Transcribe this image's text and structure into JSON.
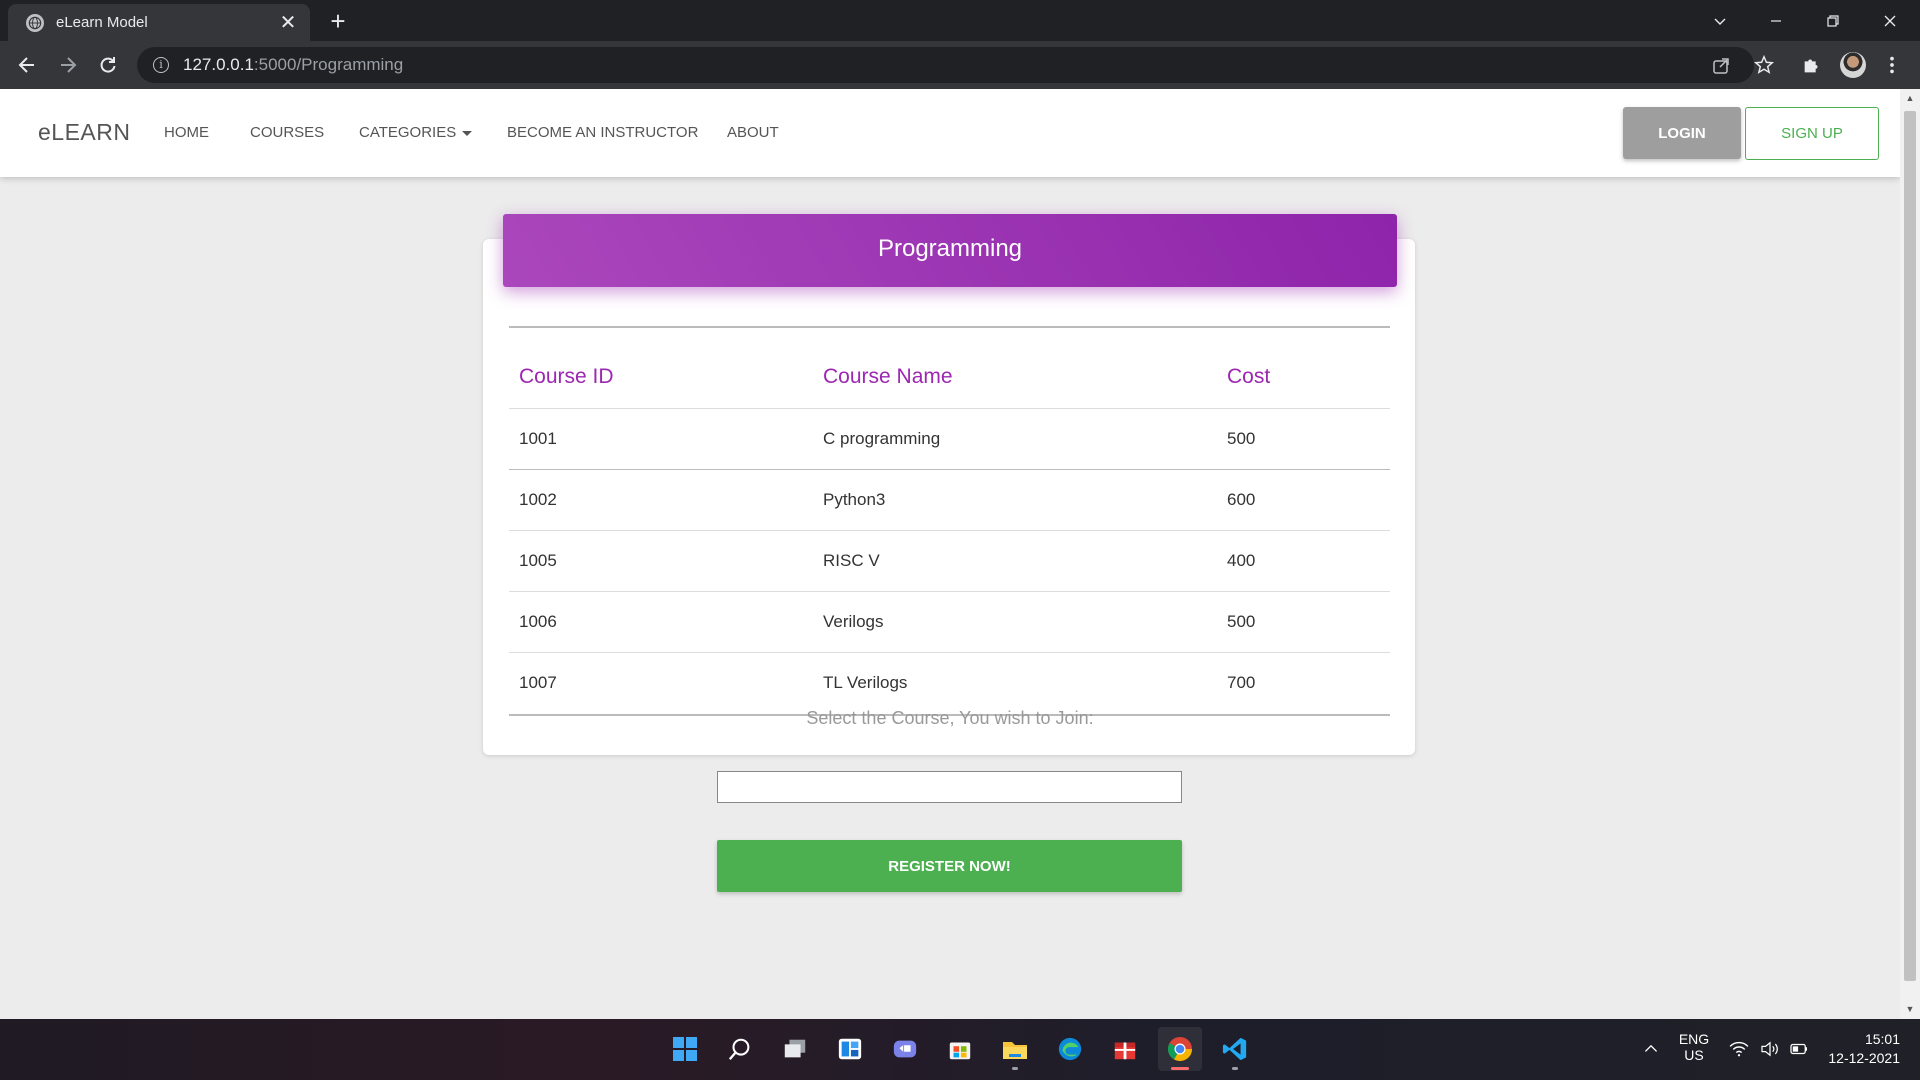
{
  "browser": {
    "tab_title": "eLearn Model",
    "tab_close": "✕",
    "new_tab": "+",
    "url_host": "127.0.0.1",
    "url_path": ":5000/Programming"
  },
  "navbar": {
    "brand": "eLEARN",
    "links": {
      "home": "HOME",
      "courses": "COURSES",
      "categories": "CATEGORIES",
      "instructor": "BECOME AN INSTRUCTOR",
      "about": "ABOUT"
    },
    "login": "LOGIN",
    "signup": "SIGN UP"
  },
  "card": {
    "title": "Programming",
    "headers": {
      "id": "Course ID",
      "name": "Course Name",
      "cost": "Cost"
    },
    "rows": [
      {
        "id": "1001",
        "name": "C programming",
        "cost": "500"
      },
      {
        "id": "1002",
        "name": "Python3",
        "cost": "600"
      },
      {
        "id": "1005",
        "name": "RISC V",
        "cost": "400"
      },
      {
        "id": "1006",
        "name": "Verilogs",
        "cost": "500"
      },
      {
        "id": "1007",
        "name": "TL Verilogs",
        "cost": "700"
      }
    ]
  },
  "register": {
    "label": "Select the Course, You wish to Join:",
    "input_value": "",
    "button": "REGISTER NOW!"
  },
  "taskbar": {
    "lang_top": "ENG",
    "lang_bottom": "US",
    "time": "15:01",
    "date": "12-12-2021"
  },
  "colors": {
    "accent_purple": "#9c27b0",
    "success_green": "#4caf50",
    "login_grey": "#9e9e9e"
  }
}
